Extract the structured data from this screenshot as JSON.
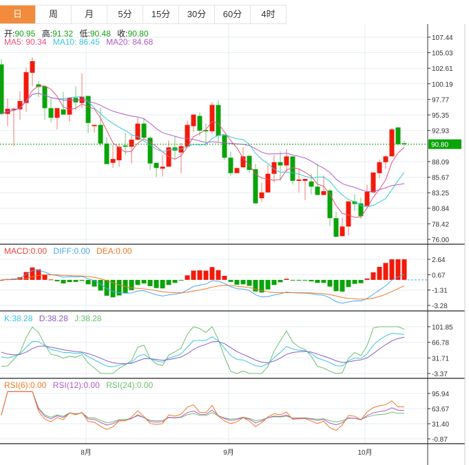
{
  "tabs": [
    {
      "label": "日",
      "active": true
    },
    {
      "label": "周"
    },
    {
      "label": "月"
    },
    {
      "label": "5分"
    },
    {
      "label": "15分"
    },
    {
      "label": "30分"
    },
    {
      "label": "60分"
    },
    {
      "label": "4时"
    }
  ],
  "ohlc": {
    "open_label": "开:",
    "open": "90.95",
    "high_label": "高:",
    "high": "91.32",
    "low_label": "低:",
    "low": "90.48",
    "close_label": "收:",
    "close": "90.80"
  },
  "ma": {
    "ma5": "MA5: 90.34",
    "ma10": "MA10: 86.45",
    "ma20": "MA20: 84.68"
  },
  "macd_legend": {
    "macd": "MACD:0.00",
    "diff": "DIFF:0.00",
    "dea": "DEA:0.00"
  },
  "kdj_legend": {
    "k": "K:38.28",
    "d": "D:38.28",
    "j": "J:38.28"
  },
  "rsi_legend": {
    "rsi6": "RSI(6):0.00",
    "rsi12": "RSI(12):0.00",
    "rsi24": "RSI(24):0.00"
  },
  "current_price": "90.80",
  "colors": {
    "up": "#f21a0a",
    "down": "#0aa30a",
    "ma5": "#ea4f7d",
    "ma10": "#38c6dc",
    "ma20": "#b35ac8",
    "accent": "#f28c3c",
    "diff": "#4aa8f0",
    "dea": "#f07820",
    "k": "#38c6dc",
    "d": "#8a5ac8",
    "j": "#6cbf6c"
  },
  "chart_data": {
    "type": "candlestick",
    "price_axis": [
      "107.44",
      "105.03",
      "102.61",
      "100.19",
      "97.77",
      "95.35",
      "92.93",
      "88.09",
      "85.67",
      "83.25",
      "80.84",
      "78.42",
      "76.00"
    ],
    "price_range": [
      76.0,
      107.44
    ],
    "macd_axis": [
      "2.64",
      "0.67",
      "-1.31",
      "-3.28"
    ],
    "macd_range": [
      -3.28,
      2.64
    ],
    "kdj_axis": [
      "101.85",
      "66.78",
      "31.71",
      "-3.37"
    ],
    "kdj_range": [
      -3.37,
      101.85
    ],
    "rsi_axis": [
      "95.94",
      "63.67",
      "31.40",
      "-0.87"
    ],
    "rsi_range": [
      -0.87,
      95.94
    ],
    "x_labels": [
      {
        "label": "8月",
        "index": 14
      },
      {
        "label": "9月",
        "index": 37
      },
      {
        "label": "10月",
        "index": 59
      }
    ],
    "candles": [
      [
        103.2,
        104.0,
        95.3,
        95.5
      ],
      [
        95.5,
        97.9,
        93.6,
        96.3
      ],
      [
        96.2,
        96.5,
        90.5,
        96.3
      ],
      [
        96.2,
        99.0,
        94.6,
        97.5
      ],
      [
        97.2,
        102.7,
        95.8,
        102.0
      ],
      [
        101.9,
        104.3,
        99.8,
        103.7
      ],
      [
        100.1,
        100.6,
        98.1,
        99.7
      ],
      [
        99.8,
        99.8,
        94.6,
        96.4
      ],
      [
        96.4,
        97.9,
        94.2,
        94.9
      ],
      [
        94.9,
        96.4,
        93.1,
        96.4
      ],
      [
        96.2,
        98.9,
        95.4,
        95.4
      ],
      [
        95.4,
        98.0,
        94.3,
        98.0
      ],
      [
        98.0,
        99.8,
        96.1,
        97.3
      ],
      [
        97.2,
        101.8,
        96.4,
        98.2
      ],
      [
        98.3,
        98.3,
        92.5,
        94.1
      ],
      [
        93.6,
        93.8,
        92.6,
        93.8
      ],
      [
        93.8,
        96.5,
        90.4,
        90.9
      ],
      [
        90.9,
        91.8,
        87.7,
        87.7
      ],
      [
        87.9,
        90.7,
        87.1,
        88.5
      ],
      [
        88.3,
        90.9,
        87.3,
        90.4
      ],
      [
        90.6,
        92.6,
        89.1,
        90.4
      ],
      [
        90.4,
        92.2,
        87.8,
        91.5
      ],
      [
        91.5,
        95.1,
        91.4,
        94.0
      ],
      [
        94.0,
        94.9,
        91.6,
        91.8
      ],
      [
        91.8,
        92.0,
        86.8,
        87.8
      ],
      [
        87.9,
        87.9,
        85.7,
        87.1
      ],
      [
        87.0,
        89.1,
        85.8,
        87.3
      ],
      [
        87.3,
        91.4,
        87.3,
        90.3
      ],
      [
        90.3,
        92.0,
        88.5,
        89.8
      ],
      [
        89.5,
        91.0,
        86.3,
        90.5
      ],
      [
        90.4,
        94.5,
        90.4,
        93.8
      ],
      [
        93.6,
        95.4,
        92.7,
        95.4
      ],
      [
        95.2,
        95.7,
        92.1,
        92.9
      ],
      [
        93.0,
        94.0,
        90.5,
        92.8
      ],
      [
        92.8,
        97.3,
        92.4,
        96.9
      ],
      [
        96.9,
        97.6,
        91.1,
        92.1
      ],
      [
        92.2,
        92.2,
        88.3,
        88.7
      ],
      [
        88.7,
        89.6,
        85.9,
        86.3
      ],
      [
        86.3,
        87.1,
        86.3,
        87.1
      ],
      [
        87.2,
        90.3,
        87.2,
        88.9
      ],
      [
        89.0,
        89.0,
        86.3,
        86.8
      ],
      [
        86.9,
        87.7,
        81.6,
        81.6
      ],
      [
        82.4,
        84.8,
        81.8,
        83.3
      ],
      [
        83.3,
        87.6,
        83.3,
        86.2
      ],
      [
        86.2,
        89.1,
        84.9,
        88.0
      ],
      [
        88.0,
        89.7,
        85.1,
        87.5
      ],
      [
        87.5,
        90.0,
        86.5,
        88.9
      ],
      [
        88.9,
        88.9,
        84.5,
        85.1
      ],
      [
        85.1,
        87.0,
        83.3,
        85.3
      ],
      [
        85.1,
        85.4,
        82.1,
        85.4
      ],
      [
        85.0,
        86.2,
        83.0,
        84.2
      ],
      [
        84.2,
        87.8,
        82.9,
        82.9
      ],
      [
        82.9,
        85.9,
        82.9,
        83.5
      ],
      [
        83.6,
        83.9,
        78.1,
        79.3
      ],
      [
        79.3,
        80.3,
        76.4,
        76.4
      ],
      [
        76.5,
        79.4,
        76.5,
        78.0
      ],
      [
        78.0,
        82.0,
        76.6,
        81.9
      ],
      [
        81.9,
        83.0,
        80.4,
        81.5
      ],
      [
        81.6,
        82.5,
        79.2,
        79.6
      ],
      [
        81.2,
        84.5,
        81.2,
        83.4
      ],
      [
        83.3,
        86.4,
        83.3,
        86.4
      ],
      [
        86.3,
        88.4,
        85.5,
        88.0
      ],
      [
        88.0,
        89.1,
        87.0,
        88.9
      ],
      [
        88.9,
        93.3,
        88.9,
        93.1
      ],
      [
        93.4,
        93.5,
        90.6,
        90.8
      ],
      [
        90.95,
        91.32,
        90.48,
        90.8
      ]
    ]
  }
}
